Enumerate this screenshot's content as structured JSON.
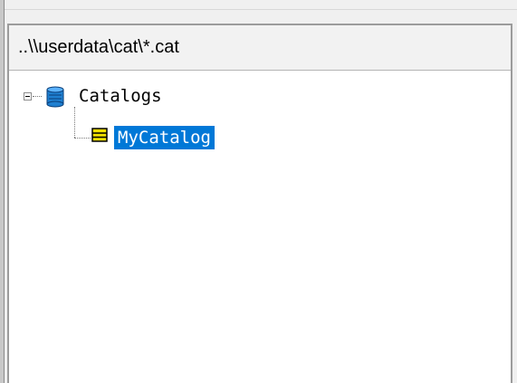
{
  "path_header": {
    "text": "..\\\\userdata\\cat\\*.cat"
  },
  "tree": {
    "root": {
      "label": "Catalogs",
      "icon": "database-icon",
      "expanded": true
    },
    "children": [
      {
        "label": "MyCatalog",
        "icon": "catalog-icon",
        "selected": true
      }
    ]
  },
  "colors": {
    "selection_bg": "#0078d7",
    "selection_text": "#ffffff",
    "db_icon": "#1e7fd0",
    "catalog_icon": "#f0e000"
  }
}
